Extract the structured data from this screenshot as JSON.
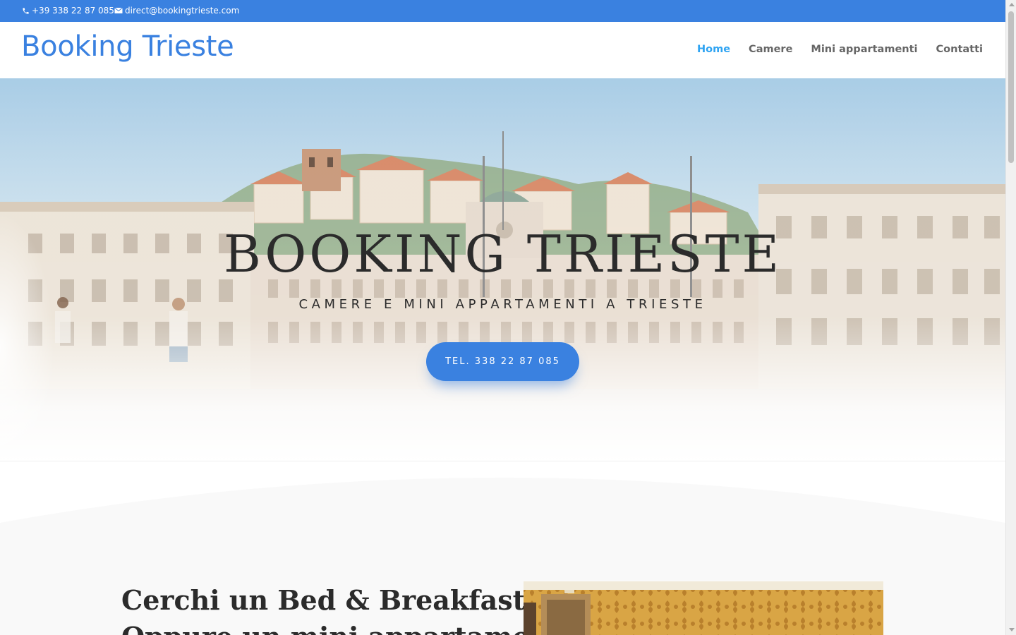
{
  "topbar": {
    "phone": "+39 338 22 87 085",
    "email": "direct@bookingtrieste.com",
    "background": "#3a81e0"
  },
  "header": {
    "logo": "Booking Trieste",
    "nav": [
      {
        "label": "Home",
        "active": true
      },
      {
        "label": "Camere",
        "active": false
      },
      {
        "label": "Mini appartamenti",
        "active": false
      },
      {
        "label": "Contatti",
        "active": false
      }
    ]
  },
  "hero": {
    "title": "BOOKING TRIESTE",
    "subtitle": "CAMERE E MINI APPARTAMENTI A TRIESTE",
    "cta": "TEL. 338 22 87 085"
  },
  "intro": {
    "heading_line1": "Cerchi un Bed & Breakfast?",
    "heading_line2": "Oppure un mini appartamento?"
  },
  "colors": {
    "accent": "#3a81e0",
    "nav_active": "#2ea3f2",
    "text_dark": "#2b2b2b"
  },
  "icons": {
    "phone": "phone-icon",
    "email": "envelope-icon"
  }
}
